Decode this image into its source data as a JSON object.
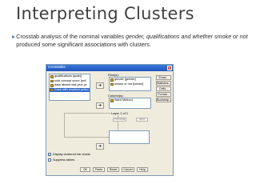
{
  "slide": {
    "title": "Interpreting Clusters",
    "bullet_symbol": "➤",
    "bullet_text_1": "Crosstab analysis of the nominal variables ",
    "bullet_italic_1": "gender, qualifications and whether smoke or not",
    "bullet_text_2": " produced some significant associations with clusters."
  },
  "dialog": {
    "title": "Crosstabs",
    "close_glyph": "×",
    "source_variables": [
      {
        "label": "qualifications [quals]",
        "selected": false
      },
      {
        "label": "sold concept score [sell",
        "selected": false
      },
      {
        "label": "days absent last year (a",
        "selected": false
      },
      {
        "label": "Case with smallest pullco",
        "selected": true
      }
    ],
    "rows_label": "Row(s):",
    "rows_items": [
      "gender [gender]",
      "smoke or not [smoke]"
    ],
    "columns_label": "Column(s):",
    "columns_items": [
      "Ward Method"
    ],
    "arrow_glyph": "➔",
    "layer_label": "Layer 1 of 1",
    "previous_button": "Previous",
    "next_button": "Next",
    "side_buttons": [
      "Exact...",
      "Statistics...",
      "Cells...",
      "Format...",
      "Bootstrap..."
    ],
    "checkbox_clustered": "Display clustered bar charts",
    "checkbox_suppress": "Suppress tables",
    "bottom_buttons": [
      "OK",
      "Paste",
      "Reset",
      "Cancel",
      "Help"
    ]
  }
}
